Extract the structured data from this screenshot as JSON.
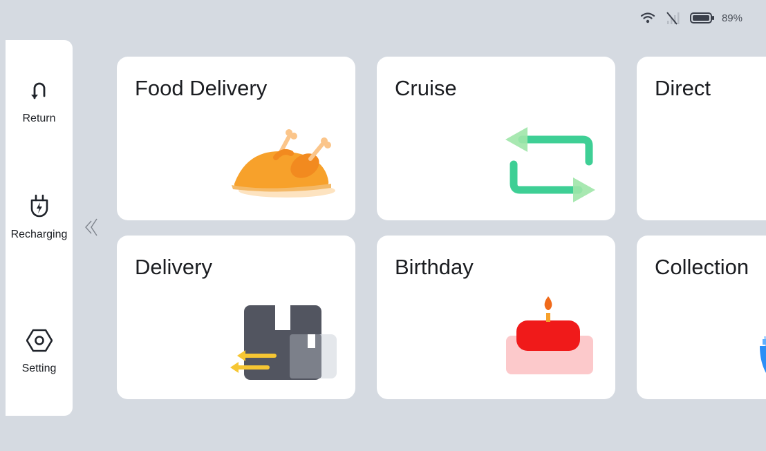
{
  "status_bar": {
    "battery_text": "89%",
    "icons": [
      "wifi-icon",
      "no-signal-icon",
      "battery-icon"
    ]
  },
  "sidebar": {
    "items": [
      {
        "label": "Return",
        "icon": "return-icon"
      },
      {
        "label": "Recharging",
        "icon": "recharge-plug-icon"
      },
      {
        "label": "Setting",
        "icon": "settings-hexagon-icon"
      }
    ],
    "collapse_icon": "double-chevron-left-icon"
  },
  "cards": [
    {
      "title": "Food Delivery",
      "icon": "roast-chicken-icon"
    },
    {
      "title": "Cruise",
      "icon": "loop-arrows-icon"
    },
    {
      "title": "Direct",
      "icon": ""
    },
    {
      "title": "Delivery",
      "icon": "box-arrows-icon"
    },
    {
      "title": "Birthday",
      "icon": "birthday-cake-icon"
    },
    {
      "title": "Collection",
      "icon": "collection-icon"
    }
  ],
  "colors": {
    "background": "#d5dae1",
    "card": "#ffffff",
    "chicken": "#f7a12b",
    "cruise_green": "#3ecf95",
    "cake_red": "#f01a1a",
    "box_gray": "#525560",
    "arrow_yellow": "#f6c633",
    "collection_blue": "#2b8ff6"
  }
}
